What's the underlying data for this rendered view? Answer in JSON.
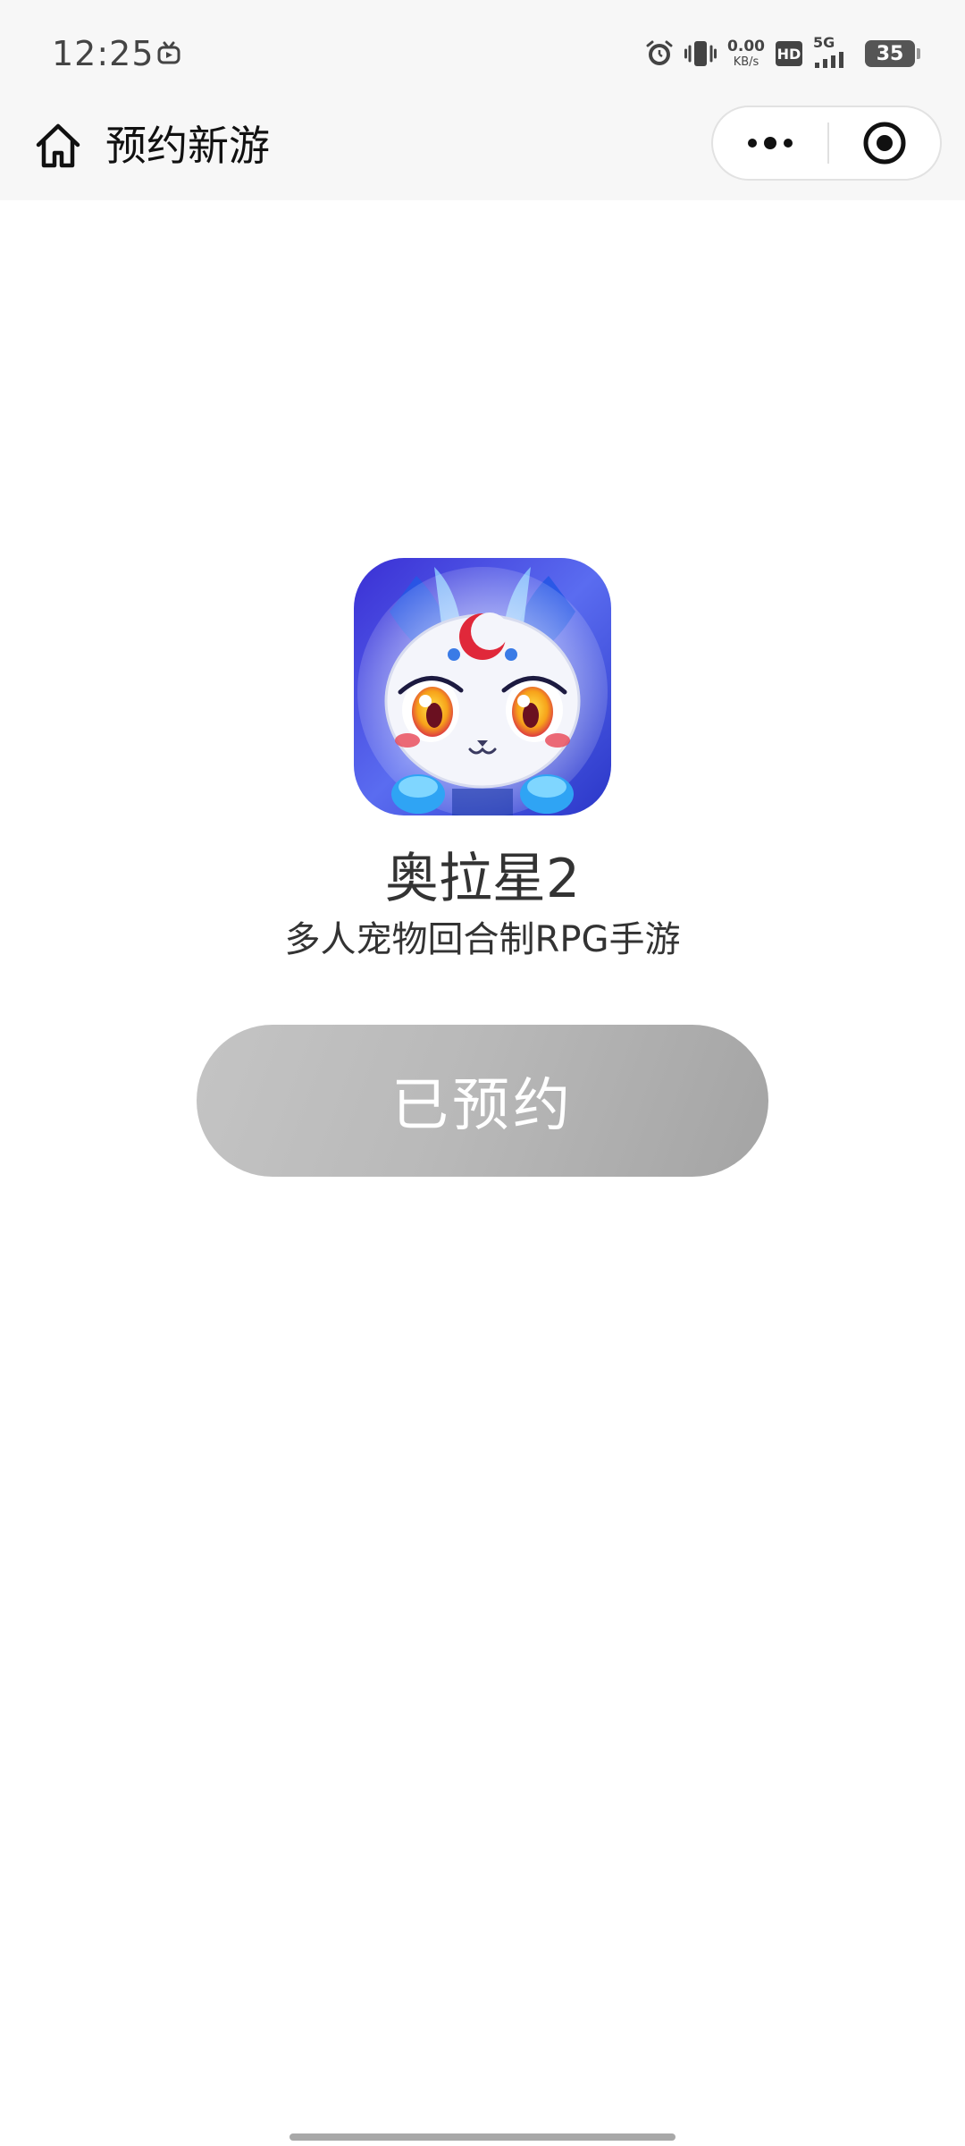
{
  "status_bar": {
    "time": "12:25",
    "net_speed_value": "0.00",
    "net_speed_unit": "KB/s",
    "hd_label": "HD",
    "network_label": "5G",
    "battery_level": "35",
    "icons": [
      "tv-icon",
      "alarm-icon",
      "vibrate-icon",
      "signal-icon",
      "battery-icon"
    ]
  },
  "nav": {
    "title": "预约新游",
    "home_icon": "home-icon",
    "more_icon": "more-dots-icon",
    "close_icon": "target-close-icon"
  },
  "game": {
    "name": "奥拉星2",
    "description": "多人宠物回合制RPG手游",
    "icon": "game-app-icon"
  },
  "reserve_button": {
    "label": "已预约",
    "state": "reserved",
    "color_from": "#c4c4c4",
    "color_to": "#a4a4a4"
  }
}
